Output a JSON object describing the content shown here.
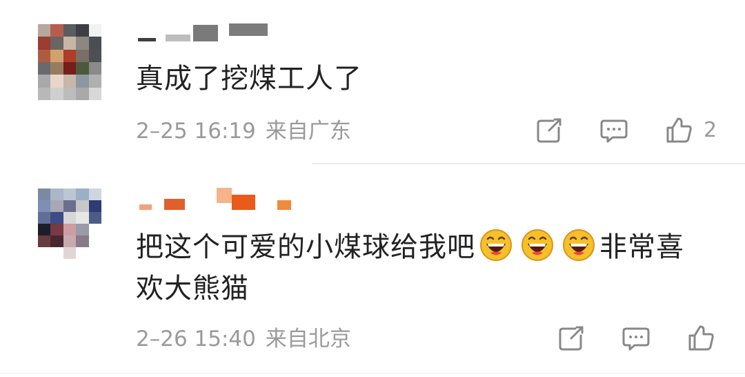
{
  "comments": [
    {
      "username": "",
      "text": "真成了挖煤工人了",
      "time": "2–25 16:19",
      "location": "来自广东",
      "like_count": "2",
      "icons": {
        "share": "share-icon",
        "comment": "comment-icon",
        "like": "thumbs-up-icon"
      }
    },
    {
      "username": "",
      "text_before": "把这个可爱的小煤球给我吧",
      "text_after_line1": "非常喜",
      "text_line2": "欢大熊猫",
      "emoji": [
        "grinning-face-emoji",
        "grinning-face-emoji",
        "grinning-face-emoji"
      ],
      "time": "2–26 15:40",
      "location": "来自北京",
      "icons": {
        "share": "share-icon",
        "comment": "comment-icon",
        "like": "thumbs-up-icon"
      }
    }
  ],
  "colors": {
    "text": "#222222",
    "meta": "#9a9a9a",
    "icon": "#888888",
    "divider": "#ececec"
  }
}
